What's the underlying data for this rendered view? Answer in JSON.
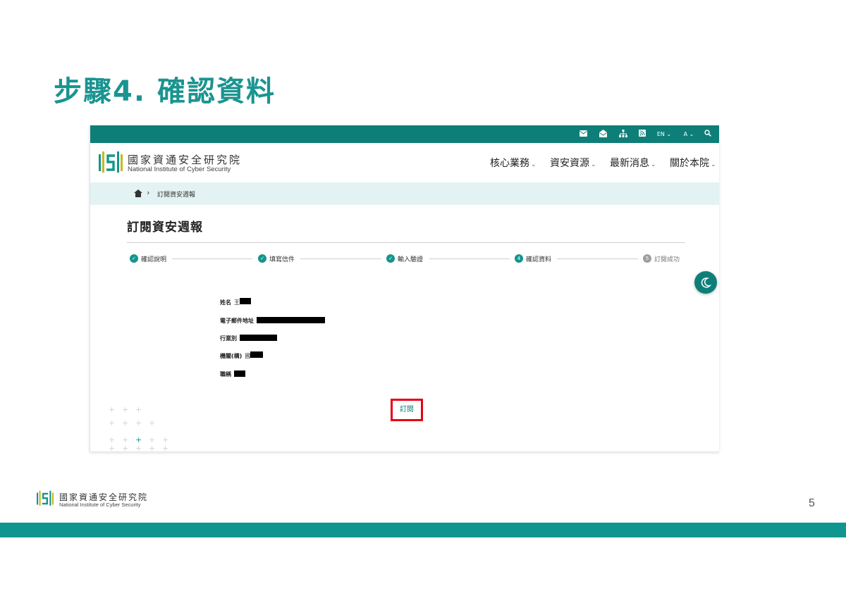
{
  "slide": {
    "title": "步驟4. 確認資料",
    "page_number": "5"
  },
  "colors": {
    "brand_teal": "#0e7f78",
    "title_teal": "#1a9490",
    "highlight_red": "#e60012",
    "breadcrumb_bg": "#e3f2f2"
  },
  "site": {
    "topbar": {
      "icons": [
        "mail-icon",
        "open-mail-icon",
        "sitemap-icon",
        "rss-icon",
        "language-select",
        "font-size-select",
        "search-icon"
      ],
      "language_label": "EN",
      "font_label": "A"
    },
    "org_name_cn": "國家資通安全研究院",
    "org_name_en": "National Institute of Cyber Security",
    "nav": [
      {
        "label": "核心業務"
      },
      {
        "label": "資安資源"
      },
      {
        "label": "最新消息"
      },
      {
        "label": "關於本院"
      }
    ],
    "breadcrumb": {
      "current": "訂閱資安週報"
    }
  },
  "page": {
    "heading": "訂閱資安週報",
    "steps": [
      {
        "number": "✓",
        "label": "確認說明",
        "status": "done"
      },
      {
        "number": "✓",
        "label": "填寫信件",
        "status": "done"
      },
      {
        "number": "✓",
        "label": "輸入驗證",
        "status": "done"
      },
      {
        "number": "4",
        "label": "確認資料",
        "status": "current"
      },
      {
        "number": "5",
        "label": "訂閱成功",
        "status": "pending"
      }
    ],
    "fields": [
      {
        "label": "姓名",
        "value_prefix": "王"
      },
      {
        "label": "電子郵件地址",
        "value_prefix": ""
      },
      {
        "label": "行業別",
        "value_prefix": ""
      },
      {
        "label": "機關(構)",
        "value_prefix": "國"
      },
      {
        "label": "職稱",
        "value_prefix": ""
      }
    ],
    "subscribe_label": "訂閱"
  },
  "footer": {
    "org_name_cn": "國家資通安全研究院",
    "org_name_en": "National Institute of Cyber Security"
  }
}
